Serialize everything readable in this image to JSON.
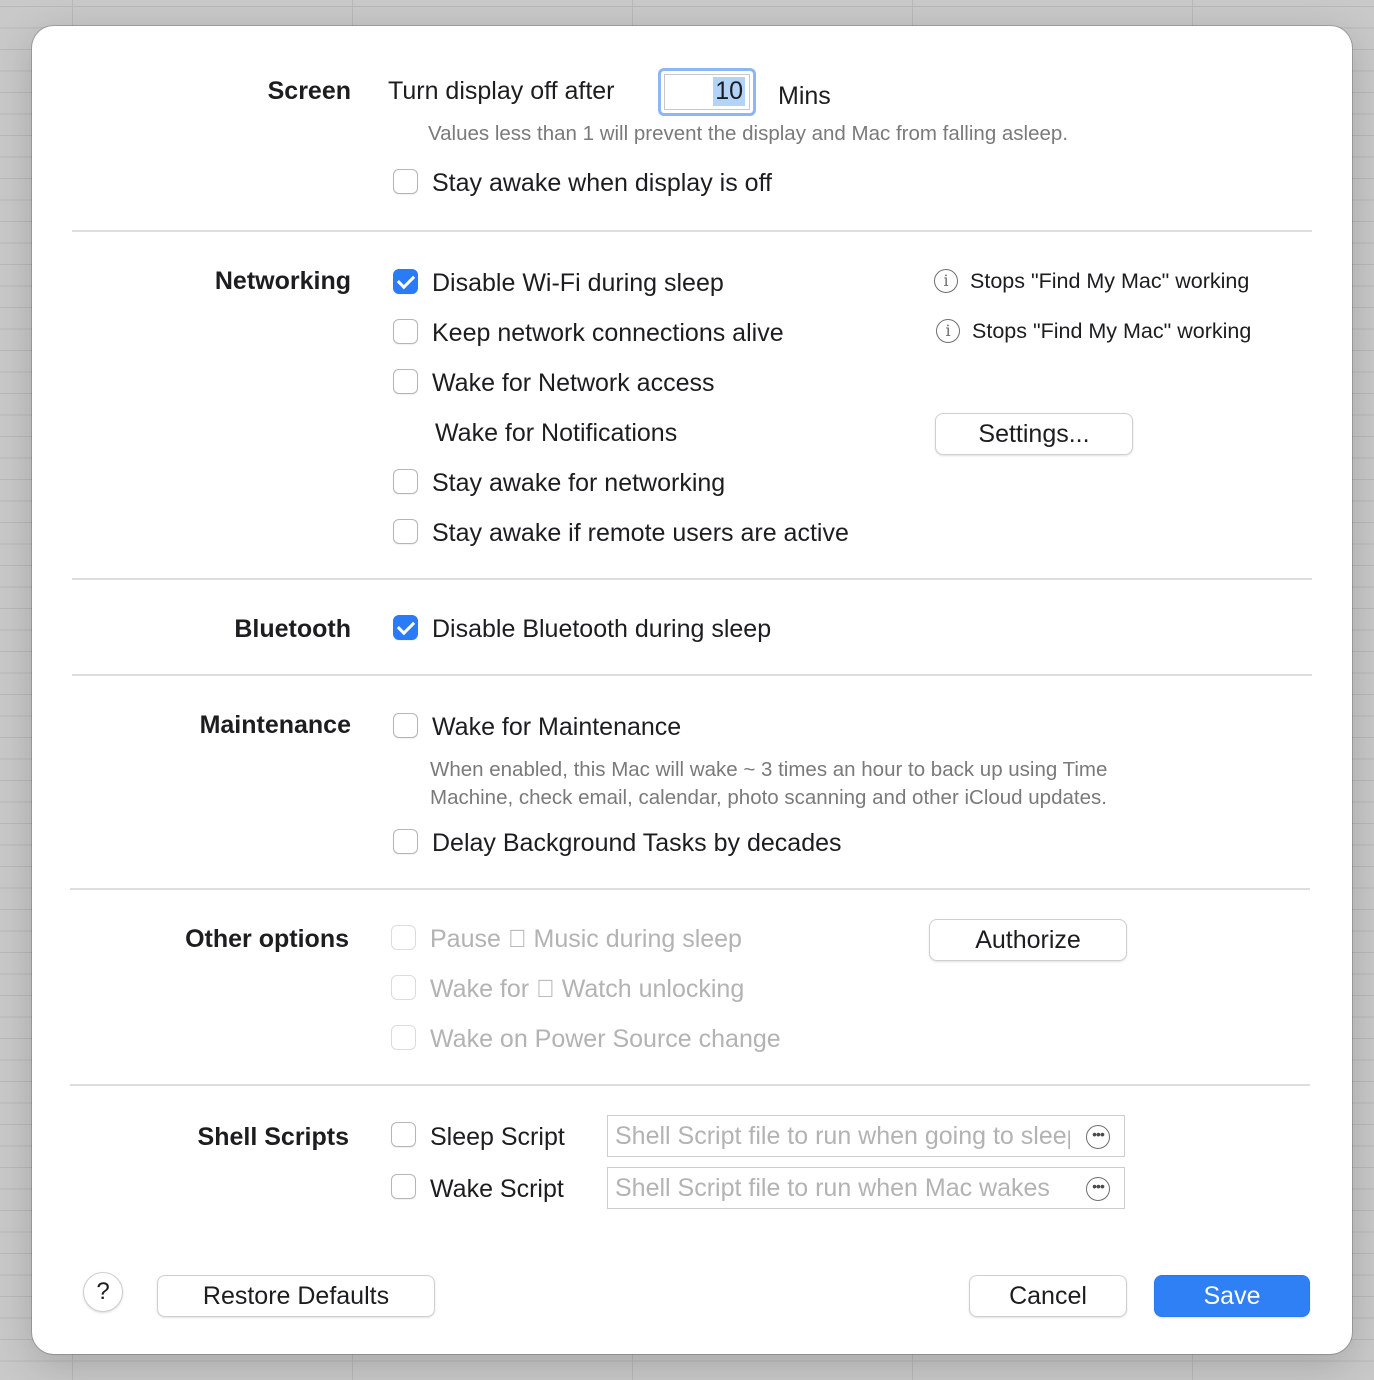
{
  "screen": {
    "label": "Screen",
    "turn_off_label": "Turn display off after",
    "minutes_value": "10",
    "unit": "Mins",
    "hint": "Values less than 1 will prevent the display and Mac from falling asleep.",
    "stay_awake_label": "Stay awake when display is off",
    "stay_awake_checked": false
  },
  "networking": {
    "label": "Networking",
    "disable_wifi_label": "Disable Wi-Fi during sleep",
    "disable_wifi_checked": true,
    "disable_wifi_note": "Stops \"Find My Mac\" working",
    "keep_alive_label": "Keep network connections alive",
    "keep_alive_checked": false,
    "keep_alive_note": "Stops \"Find My Mac\" working",
    "wake_network_label": "Wake for Network access",
    "wake_network_checked": false,
    "wake_notifications_label": "Wake for Notifications",
    "settings_button": "Settings...",
    "stay_awake_networking_label": "Stay awake for networking",
    "stay_awake_networking_checked": false,
    "stay_awake_remote_label": "Stay awake if remote users are active",
    "stay_awake_remote_checked": false
  },
  "bluetooth": {
    "label": "Bluetooth",
    "disable_label": "Disable Bluetooth during sleep",
    "disable_checked": true
  },
  "maintenance": {
    "label": "Maintenance",
    "wake_label": "Wake for Maintenance",
    "wake_checked": false,
    "hint_line1": "When enabled, this Mac will wake ~ 3 times an hour to back up using Time",
    "hint_line2": "Machine, check email, calendar, photo scanning and other iCloud updates.",
    "delay_label": "Delay Background Tasks by decades",
    "delay_checked": false
  },
  "other": {
    "label": "Other options",
    "pause_music_label": "Pause  Music during sleep",
    "wake_watch_label": "Wake for  Watch unlocking",
    "wake_power_label": "Wake on Power Source change",
    "authorize_button": "Authorize"
  },
  "scripts": {
    "label": "Shell Scripts",
    "sleep_label": "Sleep Script",
    "sleep_placeholder": "Shell Script file to run when going to sleep",
    "wake_label": "Wake Script",
    "wake_placeholder": "Shell Script file to run when Mac wakes"
  },
  "footer": {
    "help": "?",
    "restore_button": "Restore Defaults",
    "cancel_button": "Cancel",
    "save_button": "Save"
  },
  "colors": {
    "accent": "#2a7cf6",
    "save_button": "#2f7ff5",
    "divider": "#dedede",
    "muted_text": "#b3b3b3"
  },
  "icons": {
    "info": "info-circle-icon",
    "more": "ellipsis-circle-icon",
    "apple": "apple-logo-icon"
  }
}
